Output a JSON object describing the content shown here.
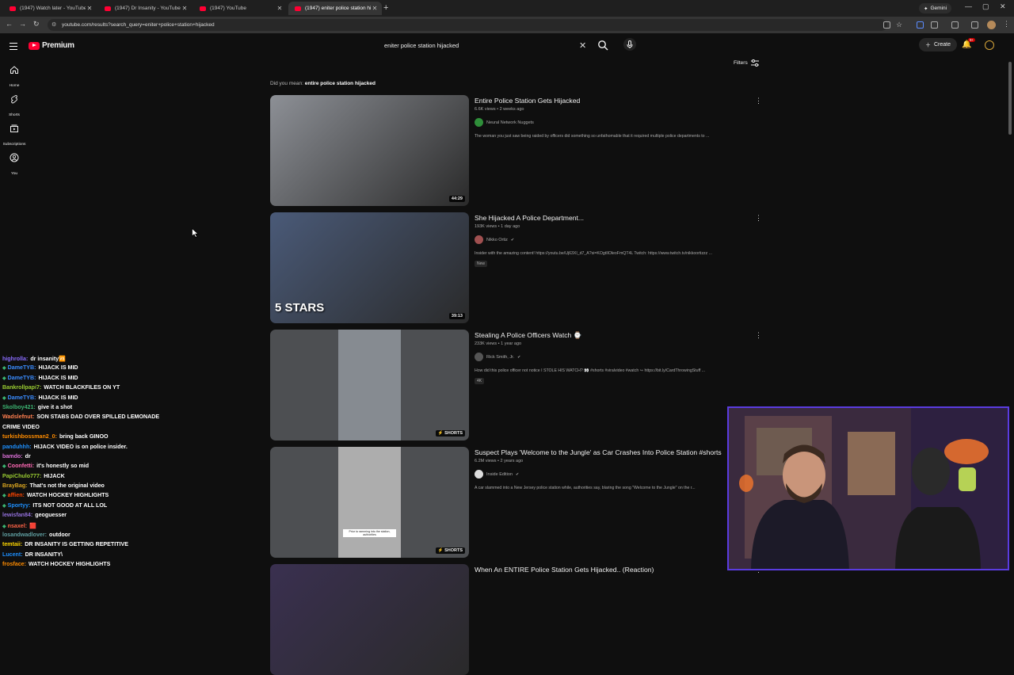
{
  "browser": {
    "tabs": [
      {
        "title": "(1947) Watch later - YouTube",
        "active": false
      },
      {
        "title": "(1947) Dr Insanity - YouTube",
        "active": false
      },
      {
        "title": "(1947) YouTube",
        "active": false
      },
      {
        "title": "(1947) eniter police station hija...",
        "active": true
      }
    ],
    "gemini_label": "Gemini",
    "url": "youtube.com/results?search_query=eniter+police+station+hijacked"
  },
  "header": {
    "logo_text": "Premium",
    "search_value": "eniter police station hijacked",
    "create_label": "Create",
    "notification_count": "9+"
  },
  "rail": [
    {
      "label": "Home",
      "icon": "home-icon"
    },
    {
      "label": "Shorts",
      "icon": "shorts-icon"
    },
    {
      "label": "Subscriptions",
      "icon": "subscriptions-icon"
    },
    {
      "label": "You",
      "icon": "you-icon"
    }
  ],
  "filters_label": "Filters",
  "did_you_mean": {
    "prefix": "Did you mean:",
    "query": "entire police station hijacked"
  },
  "results": [
    {
      "title": "Entire Police Station Gets Hijacked",
      "meta": "6.6K views • 2 weeks ago",
      "channel": "Neural Network Nuggets",
      "verified": false,
      "description": "The woman you just saw being raided by officers did something so unfathomable that it required multiple police departments to ...",
      "duration": "44:29",
      "badge": "",
      "thumb_color": "#8d9096",
      "avatar_color": "#2f8f3a"
    },
    {
      "title": "She Hijacked A Police Department...",
      "meta": "193K views • 1 day ago",
      "channel": "Nikko Ortiz",
      "verified": true,
      "description": "Insider with the amazing content! https://youtu.be/Uj63XI_d7_A?si=KOgtIlOleoFmQT4L Twitch: https://www.twitch.tv/nikkoortizzz ...",
      "duration": "39:13",
      "badge": "New",
      "thumb_color": "#4a5a78",
      "avatar_color": "#a05050",
      "thumb_caption": "5 STARS"
    },
    {
      "title": "Stealing A Police Officers Watch ⌚",
      "meta": "233K views • 1 year ago",
      "channel": "Rick Smith, Jr.",
      "verified": true,
      "description": "How did this police officer not notice I STOLE HIS WATCH? 👀 #shorts #viralvideo #watch ↪ https://bit.ly/CardThrowingStuff ...",
      "duration": "SHORTS",
      "badge": "4K",
      "thumb_color": "#6b6f74",
      "avatar_color": "#555555"
    },
    {
      "title": "Suspect Plays 'Welcome to the Jungle' as Car Crashes Into Police Station #shorts",
      "meta": "6.2M views • 2 years ago",
      "channel": "Inside Edition",
      "verified": true,
      "description": "A car slammed into a New Jersey police station while, authorities say, blaring the song \"Welcome to the Jungle\" on the r...",
      "duration": "SHORTS",
      "badge": "",
      "thumb_color": "#8a8a8a",
      "avatar_color": "#dddddd",
      "thumb_caption": "Prior to ramming into the station, authorities"
    },
    {
      "title": "When An ENTIRE Police Station Gets Hijacked.. (Reaction)",
      "meta": "",
      "channel": "",
      "verified": false,
      "description": "",
      "duration": "",
      "badge": "",
      "thumb_color": "#3a3050",
      "avatar_color": "#333333"
    }
  ],
  "chat": [
    {
      "user": "highrolla:",
      "msg": "dr insanity🆚",
      "color": "#8a6cff",
      "badge": false
    },
    {
      "user": "DameTYB:",
      "msg": "HIJACK IS MID",
      "color": "#3a8cff",
      "badge": true
    },
    {
      "user": "DameTYB:",
      "msg": "HIJACK IS MID",
      "color": "#3a8cff",
      "badge": true
    },
    {
      "user": "Bankrollpapi7:",
      "msg": "WATCH BLACKFILES ON YT",
      "color": "#9acd32",
      "badge": false
    },
    {
      "user": "DameTYB:",
      "msg": "HIJACK IS MID",
      "color": "#3a8cff",
      "badge": true
    },
    {
      "user": "Skolboy421:",
      "msg": "give it a shot",
      "color": "#3cb371",
      "badge": false
    },
    {
      "user": "Wadslefnut:",
      "msg": "SON STABS DAD OVER SPILLED LEMONADE",
      "color": "#ff7f50",
      "badge": false
    },
    {
      "user": "",
      "msg": "CRIME VIDEO",
      "color": "#ffffff",
      "badge": false
    },
    {
      "user": "turkishbossman2_0:",
      "msg": "bring back GINOO",
      "color": "#ff8c00",
      "badge": false
    },
    {
      "user": "panduhhh:",
      "msg": "HIJACK VIDEO is on police insider.",
      "color": "#1e90ff",
      "badge": false
    },
    {
      "user": "bamdo:",
      "msg": "dr",
      "color": "#da70d6",
      "badge": false
    },
    {
      "user": "Coonfetti:",
      "msg": "it's honestly so mid",
      "color": "#ff69b4",
      "badge": true
    },
    {
      "user": "PapiChulo777:",
      "msg": "HIJACK",
      "color": "#9acd32",
      "badge": false
    },
    {
      "user": "BrayBag:",
      "msg": "That's not the original video",
      "color": "#daa520",
      "badge": false
    },
    {
      "user": "affien:",
      "msg": "WATCH HOCKEY HIGHLIGHTS",
      "color": "#ff4500",
      "badge": true
    },
    {
      "user": "Sportyy:",
      "msg": "ITS NOT GOOD AT ALL LOL",
      "color": "#1e90ff",
      "badge": true
    },
    {
      "user": "lewisfan84:",
      "msg": "geoguesser",
      "color": "#9370db",
      "badge": false
    },
    {
      "user": "nsaxel:",
      "msg": "🟥",
      "color": "#ff6347",
      "badge": true
    },
    {
      "user": "losandwadlover:",
      "msg": "outdoor",
      "color": "#5f9ea0",
      "badge": false
    },
    {
      "user": "temtaii:",
      "msg": "DR INSANITY IS GETTING REPETITIVE",
      "color": "#ffd700",
      "badge": false
    },
    {
      "user": "Lucent:",
      "msg": "DR INSANITY\\",
      "color": "#1e90ff",
      "badge": false
    },
    {
      "user": "frosface:",
      "msg": "WATCH HOCKEY HIGHLIGHTS",
      "color": "#ff8c00",
      "badge": false
    }
  ]
}
